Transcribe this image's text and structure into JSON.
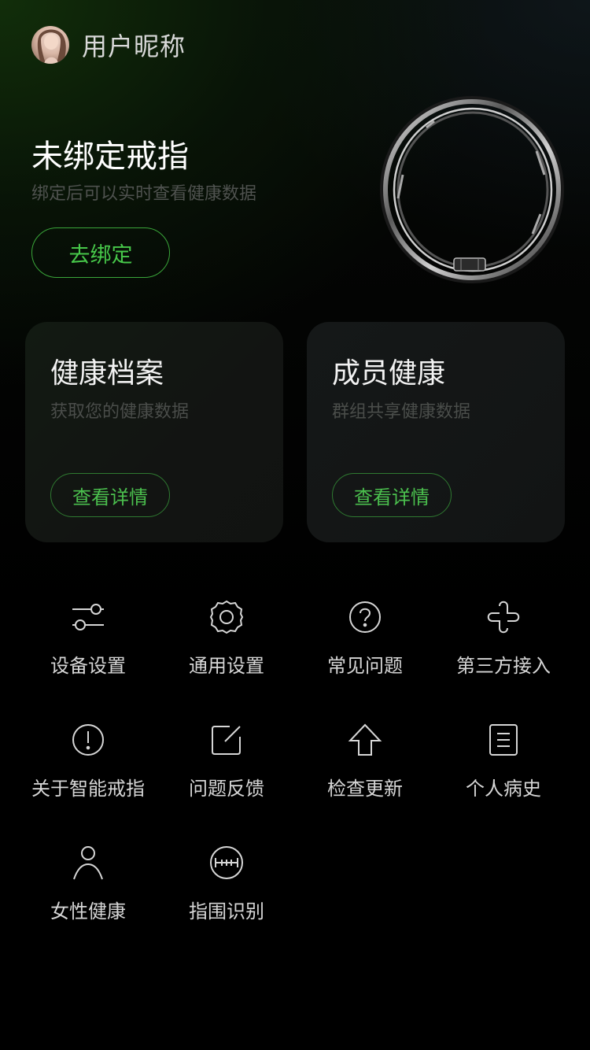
{
  "header": {
    "nickname": "用户昵称",
    "avatar_icon": "user-avatar-photo"
  },
  "bind": {
    "title": "未绑定戒指",
    "subtitle": "绑定后可以实时查看健康数据",
    "button_label": "去绑定",
    "image": "smart-ring-image"
  },
  "cards": [
    {
      "title": "健康档案",
      "subtitle": "获取您的健康数据",
      "button_label": "查看详情"
    },
    {
      "title": "成员健康",
      "subtitle": "群组共享健康数据",
      "button_label": "查看详情"
    }
  ],
  "menu": [
    {
      "label": "设备设置",
      "icon": "sliders-icon"
    },
    {
      "label": "通用设置",
      "icon": "gear-icon"
    },
    {
      "label": "常见问题",
      "icon": "question-circle-icon"
    },
    {
      "label": "第三方接入",
      "icon": "link-cross-icon"
    },
    {
      "label": "关于智能戒指",
      "icon": "info-circle-icon"
    },
    {
      "label": "问题反馈",
      "icon": "edit-icon"
    },
    {
      "label": "检查更新",
      "icon": "arrow-up-icon"
    },
    {
      "label": "个人病史",
      "icon": "document-icon"
    },
    {
      "label": "女性健康",
      "icon": "person-icon"
    },
    {
      "label": "指围识别",
      "icon": "ruler-circle-icon"
    }
  ],
  "colors": {
    "accent": "#47c84a",
    "background": "#000000",
    "card": "#141617"
  }
}
